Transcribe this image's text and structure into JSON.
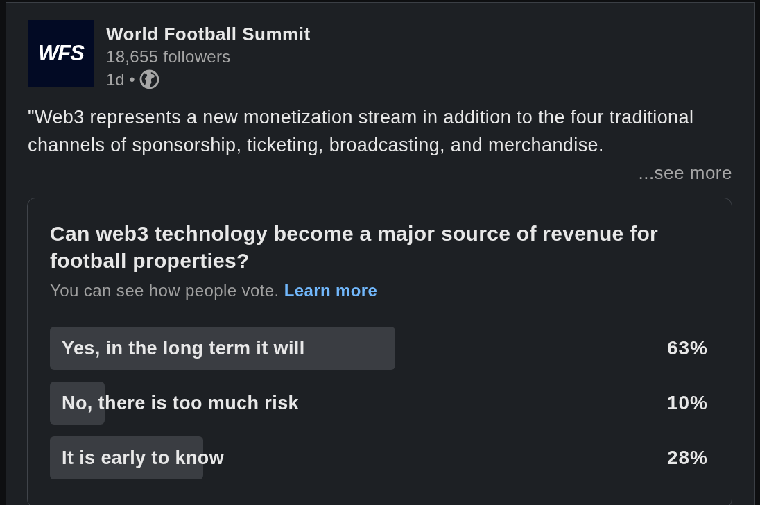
{
  "post": {
    "author": {
      "logo_text": "WFS",
      "name": "World Football Summit",
      "followers": "18,655 followers",
      "meta": "1d •"
    },
    "text": "\"Web3 represents a new monetization stream in addition to the four traditional channels of sponsorship, ticketing, broadcasting, and merchandise.",
    "see_more": "...see more"
  },
  "poll": {
    "question": "Can web3 technology become a major source of revenue for football properties?",
    "note": "You can see how people vote.",
    "learn_more": "Learn more",
    "options": [
      {
        "label": "Yes, in the long term it will",
        "percent": "63%",
        "level": 0.63
      },
      {
        "label": "No, there is too much risk",
        "percent": "10%",
        "level": 0.1
      },
      {
        "label": "It is early to know",
        "percent": "28%",
        "level": 0.28
      }
    ]
  }
}
